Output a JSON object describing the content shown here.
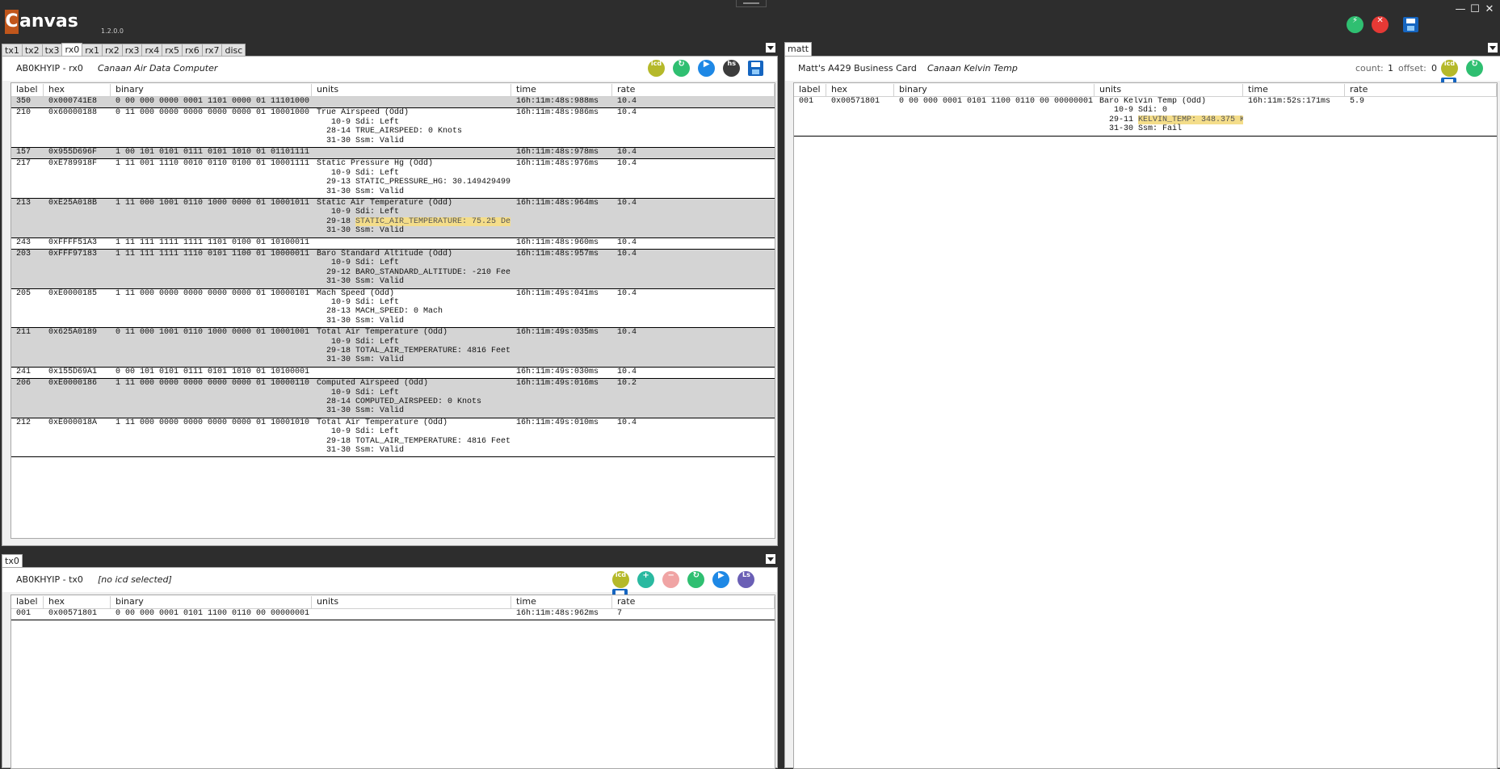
{
  "app": {
    "logo_c": "C",
    "logo_rest": "anvas",
    "version": "1.2.0.0"
  },
  "window_buttons": [
    "—",
    "☐",
    "✕"
  ],
  "top_icons": {
    "save": "save-icon"
  },
  "left_tabs": [
    "tx1",
    "tx2",
    "tx3",
    "rx0",
    "rx1",
    "rx2",
    "rx3",
    "rx4",
    "rx5",
    "rx6",
    "rx7",
    "disc"
  ],
  "left_active_tab": "rx0",
  "bottom_tabs": [
    "tx0"
  ],
  "right_tabs": [
    "matt"
  ],
  "rx0_panel": {
    "name": "AB0KHYIP - rx0",
    "icd": "Canaan Air Data Computer",
    "icons": {
      "icd": "icd",
      "hs": "hs"
    },
    "columns": [
      "label",
      "hex",
      "binary",
      "units",
      "time",
      "rate"
    ],
    "rows": [
      {
        "label": "350",
        "hex": "0x000741E8",
        "binary": "0 00 000 0000 0001 1101 0000 01 11101000",
        "units": [],
        "time": "16h:11m:48s:988ms",
        "rate": "10.4",
        "grey": true
      },
      {
        "label": "210",
        "hex": "0x60000188",
        "binary": "0 11 000 0000 0000 0000 0000 01 10001000",
        "units": [
          "True Airspeed (Odd)",
          "   10-9 Sdi: Left",
          "  28-14 TRUE_AIRSPEED: 0 Knots",
          "  31-30 Ssm: Valid"
        ],
        "time": "16h:11m:48s:986ms",
        "rate": "10.4",
        "grey": false
      },
      {
        "label": "157",
        "hex": "0x955D696F",
        "binary": "1 00 101 0101 0111 0101 1010 01 01101111",
        "units": [],
        "time": "16h:11m:48s:978ms",
        "rate": "10.4",
        "grey": true
      },
      {
        "label": "217",
        "hex": "0xE789918F",
        "binary": "1 11 001 1110 0010 0110 0100 01 10001111",
        "units": [
          "Static Pressure Hg (Odd)",
          "   10-9 Sdi: Left",
          "  29-13 STATIC_PRESSURE_HG: 30.149429499",
          "  31-30 Ssm: Valid"
        ],
        "time": "16h:11m:48s:976ms",
        "rate": "10.4",
        "grey": false
      },
      {
        "label": "213",
        "hex": "0xE25A018B",
        "binary": "1 11 000 1001 0110 1000 0000 01 10001011",
        "units": [
          "Static Air Temperature (Odd)",
          "   10-9 Sdi: Left",
          "  29-18 STATIC_AIR_TEMPERATURE: 75.25 De",
          "  31-30 Ssm: Valid"
        ],
        "highlight": 2,
        "time": "16h:11m:48s:964ms",
        "rate": "10.4",
        "grey": true
      },
      {
        "label": "243",
        "hex": "0xFFFF51A3",
        "binary": "1 11 111 1111 1111 1101 0100 01 10100011",
        "units": [],
        "time": "16h:11m:48s:960ms",
        "rate": "10.4",
        "grey": false
      },
      {
        "label": "203",
        "hex": "0xFFF97183",
        "binary": "1 11 111 1111 1110 0101 1100 01 10000011",
        "units": [
          "Baro Standard Altitude (Odd)",
          "   10-9 Sdi: Left",
          "  29-12 BARO_STANDARD_ALTITUDE: -210 Fee",
          "  31-30 Ssm: Valid"
        ],
        "time": "16h:11m:48s:957ms",
        "rate": "10.4",
        "grey": true
      },
      {
        "label": "205",
        "hex": "0xE0000185",
        "binary": "1 11 000 0000 0000 0000 0000 01 10000101",
        "units": [
          "Mach Speed (Odd)",
          "   10-9 Sdi: Left",
          "  28-13 MACH_SPEED: 0 Mach",
          "  31-30 Ssm: Valid"
        ],
        "time": "16h:11m:49s:041ms",
        "rate": "10.4",
        "grey": false
      },
      {
        "label": "211",
        "hex": "0x625A0189",
        "binary": "0 11 000 1001 0110 1000 0000 01 10001001",
        "units": [
          "Total Air Temperature (Odd)",
          "   10-9 Sdi: Left",
          "  29-18 TOTAL_AIR_TEMPERATURE: 4816 Feet",
          "  31-30 Ssm: Valid"
        ],
        "time": "16h:11m:49s:035ms",
        "rate": "10.4",
        "grey": true
      },
      {
        "label": "241",
        "hex": "0x155D69A1",
        "binary": "0 00 101 0101 0111 0101 1010 01 10100001",
        "units": [],
        "time": "16h:11m:49s:030ms",
        "rate": "10.4",
        "grey": false
      },
      {
        "label": "206",
        "hex": "0xE0000186",
        "binary": "1 11 000 0000 0000 0000 0000 01 10000110",
        "units": [
          "Computed Airspeed (Odd)",
          "   10-9 Sdi: Left",
          "  28-14 COMPUTED_AIRSPEED: 0 Knots",
          "  31-30 Ssm: Valid"
        ],
        "time": "16h:11m:49s:016ms",
        "rate": "10.2",
        "grey": true
      },
      {
        "label": "212",
        "hex": "0xE000018A",
        "binary": "1 11 000 0000 0000 0000 0000 01 10001010",
        "units": [
          "Total Air Temperature (Odd)",
          "   10-9 Sdi: Left",
          "  29-18 TOTAL_AIR_TEMPERATURE: 4816 Feet",
          "  31-30 Ssm: Valid"
        ],
        "time": "16h:11m:49s:010ms",
        "rate": "10.4",
        "grey": false
      }
    ]
  },
  "tx0_panel": {
    "name": "AB0KHYIP - tx0",
    "icd": "[no icd selected]",
    "icons": {
      "icd": "icd",
      "ls": "Ls"
    },
    "columns": [
      "label",
      "hex",
      "binary",
      "units",
      "time",
      "rate"
    ],
    "rows": [
      {
        "label": "001",
        "hex": "0x00571801",
        "binary": "0 00 000 0001 0101 1100 0110 00 00000001",
        "units": [],
        "time": "16h:11m:48s:962ms",
        "rate": "7",
        "grey": false
      }
    ]
  },
  "matt_panel": {
    "name": "Matt's A429 Business Card",
    "icd": "Canaan Kelvin Temp",
    "count_label": "count:",
    "count": "1",
    "offset_label": "offset:",
    "offset": "0",
    "icons": {
      "icd": "icd"
    },
    "columns": [
      "label",
      "hex",
      "binary",
      "units",
      "time",
      "rate"
    ],
    "rows": [
      {
        "label": "001",
        "hex": "0x00571801",
        "binary": "0 00 000 0001 0101 1100 0110 00 00000001",
        "units": [
          "Baro Kelvin Temp (Odd)",
          "   10-9 Sdi: 0",
          "  29-11 KELVIN_TEMP: 348.375 K",
          "  31-30 Ssm: Fail"
        ],
        "highlight": 2,
        "time": "16h:11m:52s:171ms",
        "rate": "5.9",
        "grey": false
      }
    ]
  }
}
